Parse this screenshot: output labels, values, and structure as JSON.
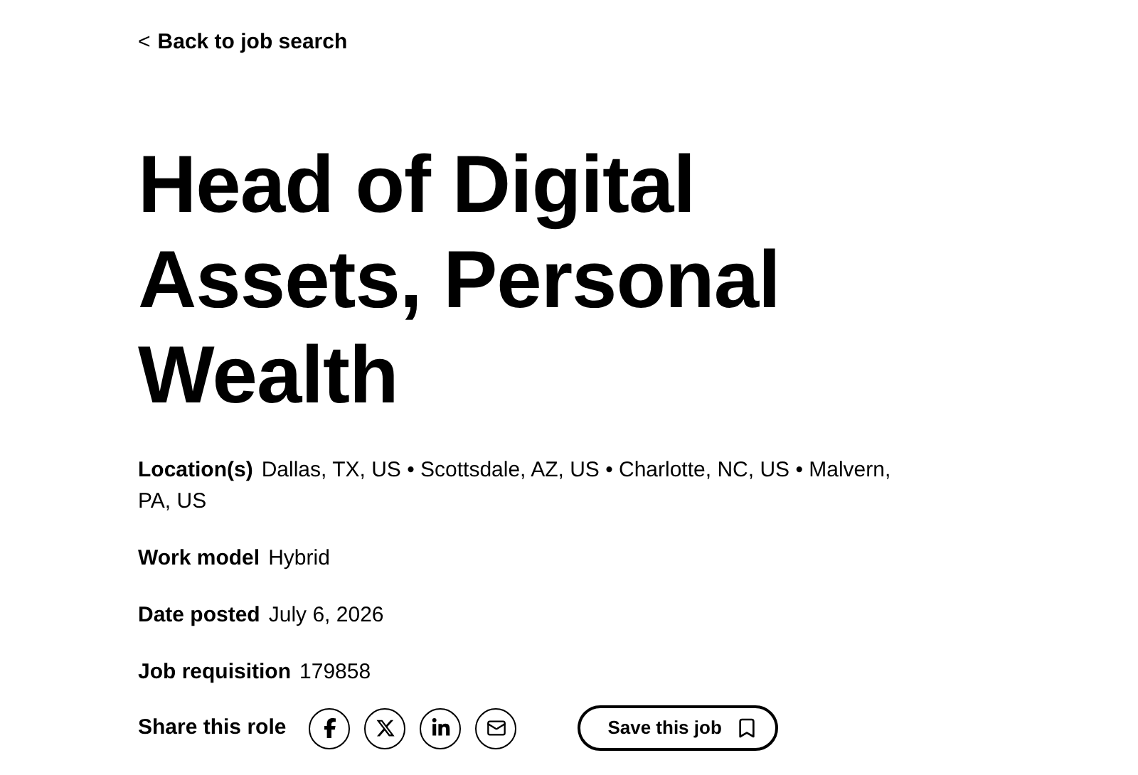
{
  "back_link": {
    "icon": "<",
    "label": "Back to job search"
  },
  "title": "Head of Digital Assets, Personal Wealth",
  "details": [
    {
      "label": "Location(s)",
      "value": "Dallas, TX, US • Scottsdale, AZ, US • Charlotte, NC, US • Malvern, PA, US"
    },
    {
      "label": "Work model",
      "value": "Hybrid"
    },
    {
      "label": "Date posted",
      "value": "July 6, 2026"
    },
    {
      "label": "Job requisition",
      "value": "179858"
    }
  ],
  "share": {
    "label": "Share this role",
    "networks": [
      {
        "kind": "facebook"
      },
      {
        "kind": "x"
      },
      {
        "kind": "linkedin"
      },
      {
        "kind": "email"
      }
    ]
  },
  "save_button": {
    "label": "Save this job"
  }
}
